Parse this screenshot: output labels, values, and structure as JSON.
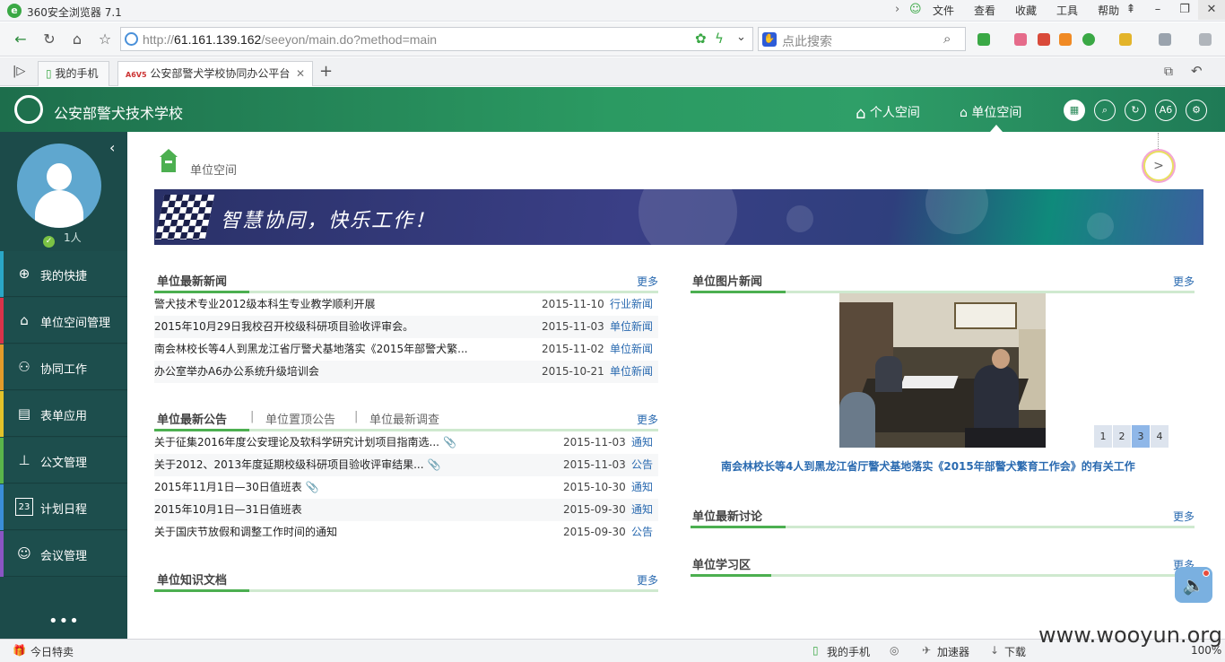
{
  "browser": {
    "title": "360安全浏览器  7.1",
    "menus": [
      "文件",
      "查看",
      "收藏",
      "工具",
      "帮助"
    ],
    "url_host": "61.161.139.162",
    "url_prefix": "http://",
    "url_path": "/seeyon/main.do?method=main",
    "search_placeholder": "点此搜索",
    "tab_phone": "我的手机",
    "tab_active": "公安部警犬学校协同办公平台",
    "status_left": "今日特卖",
    "status_phone": "我的手机",
    "status_speed": "加速器",
    "status_download": "下载",
    "zoom": "100%"
  },
  "app": {
    "brand": "公安部警犬技术学校",
    "nav_personal": "个人空间",
    "nav_unit": "单位空间",
    "icon_a6": "A6"
  },
  "sidebar": {
    "online": "1人",
    "items": [
      {
        "label": "我的快捷",
        "color": "#2aa7c7"
      },
      {
        "label": "单位空间管理",
        "color": "#d9334a"
      },
      {
        "label": "协同工作",
        "color": "#e39b2a"
      },
      {
        "label": "表单应用",
        "color": "#e3c22a"
      },
      {
        "label": "公文管理",
        "color": "#5ab54a"
      },
      {
        "label": "计划日程",
        "color": "#3a8ed9"
      },
      {
        "label": "会议管理",
        "color": "#8a55c4"
      }
    ],
    "more": "•••"
  },
  "main": {
    "crumb": "单位空间",
    "banner_slogan": "智慧协同，快乐工作！",
    "news": {
      "title": "单位最新新闻",
      "more": "更多",
      "rows": [
        {
          "title": "警犬技术专业2012级本科生专业教学顺利开展",
          "date": "2015-11-10",
          "cat": "行业新闻"
        },
        {
          "title": "2015年10月29日我校召开校级科研项目验收评审会。",
          "date": "2015-11-03",
          "cat": "单位新闻"
        },
        {
          "title": "南会林校长等4人到黑龙江省厅警犬基地落实《2015年部警犬繁...",
          "date": "2015-11-02",
          "cat": "单位新闻"
        },
        {
          "title": "办公室举办A6办公系统升级培训会",
          "date": "2015-10-21",
          "cat": "单位新闻"
        }
      ]
    },
    "notice": {
      "title": "单位最新公告",
      "tab2": "单位置顶公告",
      "tab3": "单位最新调查",
      "more": "更多",
      "rows": [
        {
          "title": "关于征集2016年度公安理论及软科学研究计划项目指南选...",
          "date": "2015-11-03",
          "cat": "通知",
          "clip": "📎"
        },
        {
          "title": "关于2012、2013年度延期校级科研项目验收评审结果...",
          "date": "2015-11-03",
          "cat": "公告",
          "clip": "📎"
        },
        {
          "title": "2015年11月1日—30日值班表",
          "date": "2015-10-30",
          "cat": "通知",
          "clip": "📎"
        },
        {
          "title": "2015年10月1日—31日值班表",
          "date": "2015-09-30",
          "cat": "通知",
          "clip": ""
        },
        {
          "title": "关于国庆节放假和调整工作时间的通知",
          "date": "2015-09-30",
          "cat": "公告",
          "clip": ""
        }
      ]
    },
    "knowledge": {
      "title": "单位知识文档",
      "more": "更多"
    },
    "photo_news": {
      "title": "单位图片新闻",
      "more": "更多",
      "caption": "南会林校长等4人到黑龙江省厅警犬基地落实《2015年部警犬繁育工作会》的有关工作",
      "pages": [
        "1",
        "2",
        "3",
        "4"
      ],
      "active_page": "3"
    },
    "discussion": {
      "title": "单位最新讨论",
      "more": "更多"
    },
    "study": {
      "title": "单位学习区",
      "more": "更多"
    }
  },
  "watermark": "www.wooyun.org"
}
